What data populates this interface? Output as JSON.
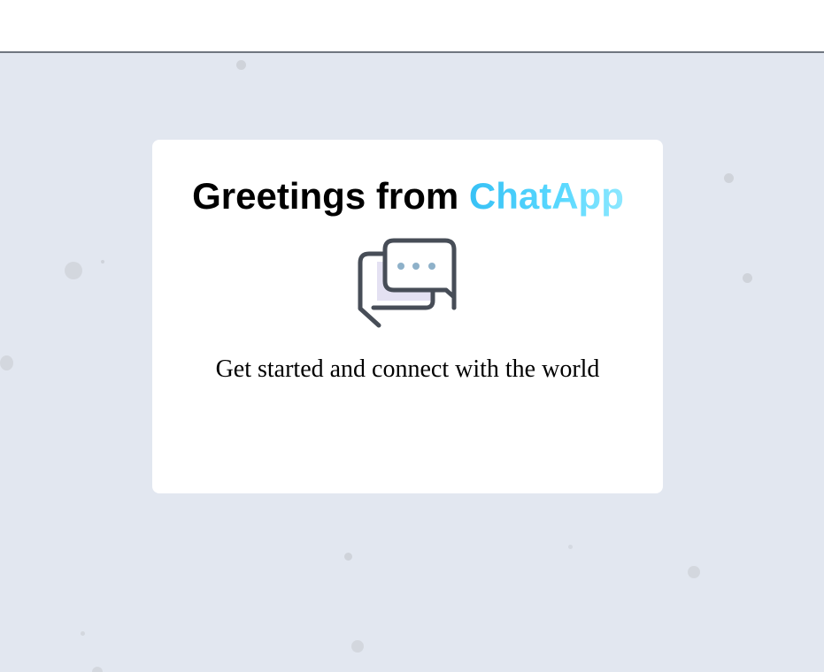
{
  "card": {
    "title_prefix": "Greetings from ",
    "title_brand": "ChatApp",
    "subtitle": "Get started and connect with the world",
    "icon": "chat-bubbles-icon"
  },
  "colors": {
    "background": "#e2e7f0",
    "card": "#ffffff",
    "brand_gradient_start": "#37c1f5",
    "brand_gradient_end": "#8ee8ff",
    "icon_stroke": "#474d57",
    "icon_dots": "#8eb1c9",
    "icon_fill": "#e4e1f2"
  }
}
